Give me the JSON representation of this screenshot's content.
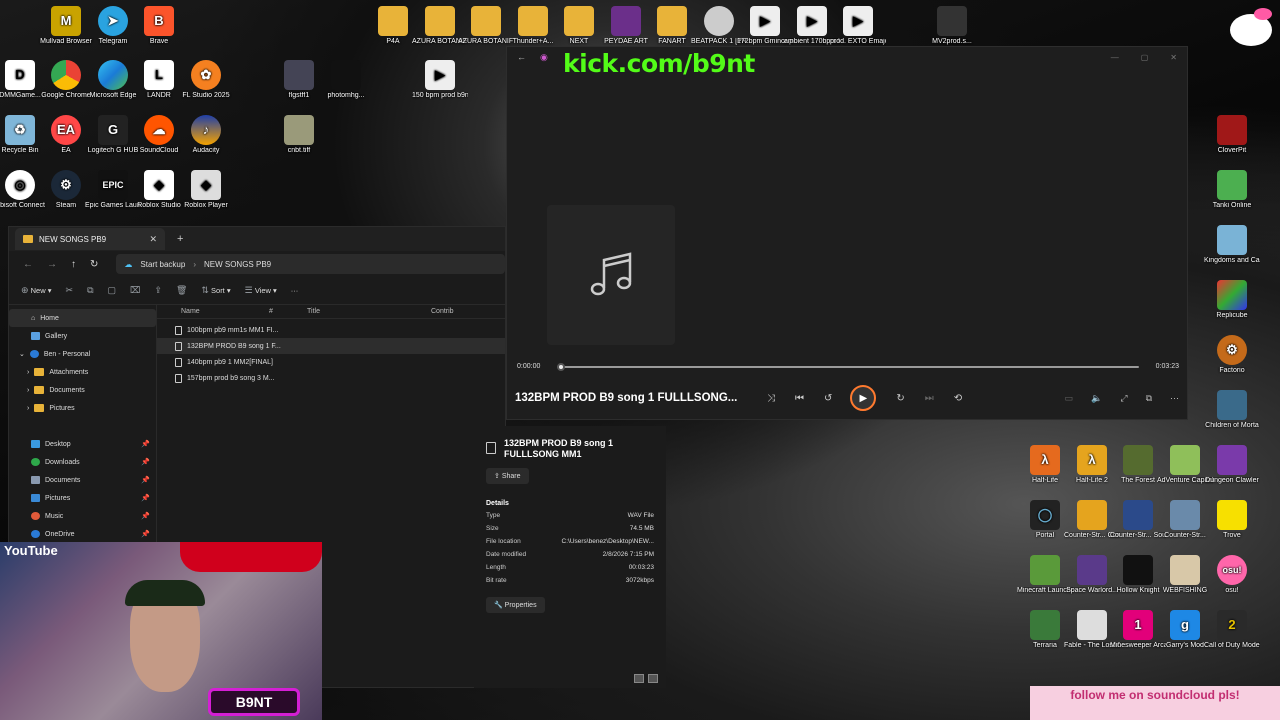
{
  "player": {
    "overlay_url": "kick.com/b9nt",
    "song_title": "132BPM PROD B9 song 1 FULLLSONG...",
    "time_current": "0:00:00",
    "time_total": "0:03:23",
    "progress": 0.0
  },
  "explorer": {
    "tab_label": "NEW SONGS PB9",
    "breadcrumb": [
      "Start backup",
      "NEW SONGS PB9"
    ],
    "commands": {
      "new": "New",
      "sort": "Sort",
      "view": "View"
    },
    "columns": [
      "Name",
      "#",
      "Title",
      "Contrib"
    ],
    "nav": {
      "home": "Home",
      "gallery": "Gallery",
      "account": "Ben - Personal",
      "attachments": "Attachments",
      "documents": "Documents",
      "pictures": "Pictures",
      "quick": [
        "Desktop",
        "Downloads",
        "Documents",
        "Pictures",
        "Music",
        "OneDrive"
      ]
    },
    "files": [
      "100bpm pb9 mm1s MM1 FI...",
      "132BPM PROD B9 song 1 F...",
      "140bpm pb9 1 MM2[FINAL]",
      "157bpm prod b9 song 3 M..."
    ]
  },
  "details": {
    "title": "132BPM PROD B9 song 1 FULLLSONG MM1",
    "share": "Share",
    "heading": "Details",
    "rows": [
      {
        "k": "Type",
        "v": "WAV File"
      },
      {
        "k": "Size",
        "v": "74.5 MB"
      },
      {
        "k": "File location",
        "v": "C:\\Users\\benez\\Desktop\\NEW..."
      },
      {
        "k": "Date modified",
        "v": "2/8/2026 7:15 PM"
      },
      {
        "k": "Length",
        "v": "00:03:23"
      },
      {
        "k": "Bit rate",
        "v": "3072kbps"
      }
    ],
    "properties": "Properties"
  },
  "desktop_icons": {
    "mullvad": "Mullvad Browser",
    "telegram": "Telegram",
    "brave": "Brave",
    "dmm": "DMMGame...",
    "chrome": "Google Chrome",
    "edge": "Microsoft Edge",
    "landr": "LANDR",
    "fl": "FL Studio 2025",
    "recycle": "Recycle Bin",
    "ea": "EA",
    "logitech": "Logitech G HUB",
    "soundcloud": "SoundCloud",
    "audacity": "Audacity",
    "ubisoft": "Ubisoft Connect",
    "steam": "Steam",
    "epic": "Epic Games Launcher",
    "roblox_studio": "Roblox Studio",
    "roblox_player": "Roblox Player",
    "p4a": "P4A",
    "azura1": "AZURA BOTANIFY 1.0",
    "azura2": "AZURA BOTANIFY 1.0",
    "thunder": "Thunder+A...",
    "next": "NEXT",
    "peydae": "PEYDAE ART",
    "fanart": "FANART",
    "beatpack": "BEATPACK 1 [PROD B9NT]",
    "gminor": "172bpm Gminor pr...",
    "ambient": "ambient 170bpm be...",
    "exto": "prod. EXTO Emajor 1...",
    "mv2": "MV2prod.s...",
    "flgstff": "flgstff1",
    "photomhg": "photomhg...",
    "b150": "150 bpm prod b9nt t...",
    "cnbt": "cnbt.tiff",
    "cloverpit": "CloverPit",
    "tanki": "Tanki Online",
    "kingdoms": "Kingdoms and Castles",
    "replicube": "Replicube",
    "factorio": "Factorio",
    "children": "Children of Morta",
    "halflife": "Half-Life",
    "halflife2": "Half-Life 2",
    "forest": "The Forest",
    "adventure": "AdVenture Capitalist",
    "dungeon": "Dungeon Clawler",
    "portal": "Portal",
    "cscz": "Counter-Str... Condition Z...",
    "cssource": "Counter-Str... Source",
    "cs": "Counter-Str...",
    "trove": "Trove",
    "minecraft": "Minecraft Launcher",
    "spacewar": "Space Warlord...",
    "hollow": "Hollow Knight",
    "webfishing": "WEBFISHING",
    "osu": "osu!",
    "terraria": "Terraria",
    "fable": "Fable - The Lost Chapters",
    "minesweeper": "Minesweeper Arcade",
    "garrys": "Garry's Mod",
    "cod": "Call of Duty Modern ..."
  },
  "overlays": {
    "youtube": "YouTube",
    "b9nt_logo": "B9NT",
    "follow_me": "follow me on soundcloud pls!"
  }
}
